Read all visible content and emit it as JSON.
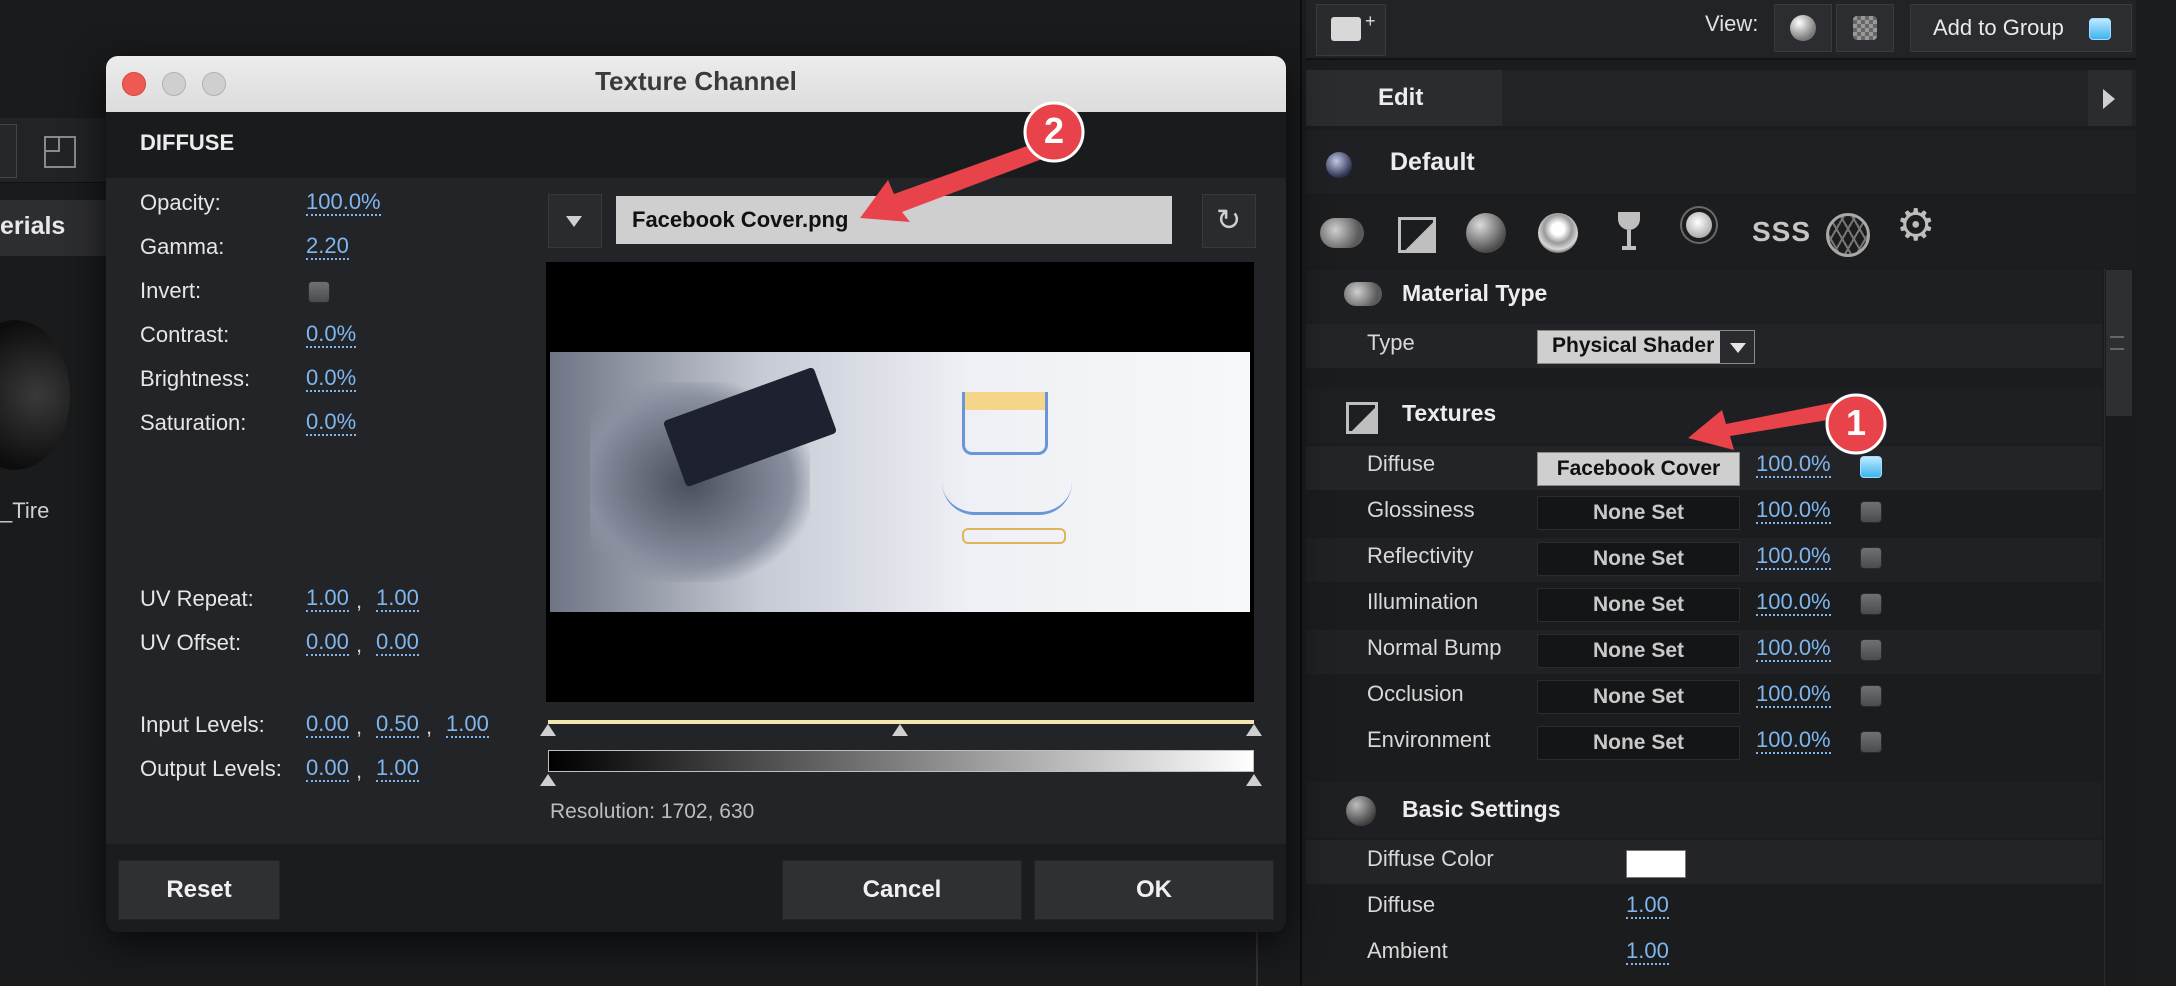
{
  "background": {
    "materials_tab_fragment": "erials",
    "tire_fragment": "_Tire"
  },
  "top_bar": {
    "view_label": "View:",
    "add_to_group_label": "Add to Group"
  },
  "right_panel": {
    "edit_tab": "Edit",
    "material_name": "Default",
    "toolbar_icons": [
      "material-icon",
      "image-icon",
      "sphere-icon",
      "metal-sphere-icon",
      "glass-icon",
      "light-bulb-icon",
      "sss-icon",
      "geodesic-icon",
      "gear-icon"
    ],
    "sss_text": "SSS",
    "material_type": {
      "heading": "Material Type",
      "type_label": "Type",
      "type_value": "Physical Shader"
    },
    "textures": {
      "heading": "Textures",
      "rows": [
        {
          "label": "Diffuse",
          "value": "Facebook Cover",
          "pct": "100.0%",
          "checked": true
        },
        {
          "label": "Glossiness",
          "value": "None Set",
          "pct": "100.0%",
          "checked": false
        },
        {
          "label": "Reflectivity",
          "value": "None Set",
          "pct": "100.0%",
          "checked": false
        },
        {
          "label": "Illumination",
          "value": "None Set",
          "pct": "100.0%",
          "checked": false
        },
        {
          "label": "Normal Bump",
          "value": "None Set",
          "pct": "100.0%",
          "checked": false
        },
        {
          "label": "Occlusion",
          "value": "None Set",
          "pct": "100.0%",
          "checked": false
        },
        {
          "label": "Environment",
          "value": "None Set",
          "pct": "100.0%",
          "checked": false
        }
      ]
    },
    "basic_settings": {
      "heading": "Basic Settings",
      "diffuse_color_label": "Diffuse Color",
      "diffuse_color": "#ffffff",
      "diffuse_label": "Diffuse",
      "diffuse_value": "1.00",
      "ambient_label": "Ambient",
      "ambient_value": "1.00"
    }
  },
  "dialog": {
    "title": "Texture Channel",
    "section": "DIFFUSE",
    "opacity_label": "Opacity:",
    "opacity": "100.0%",
    "gamma_label": "Gamma:",
    "gamma": "2.20",
    "invert_label": "Invert:",
    "contrast_label": "Contrast:",
    "contrast": "0.0%",
    "brightness_label": "Brightness:",
    "brightness": "0.0%",
    "saturation_label": "Saturation:",
    "saturation": "0.0%",
    "uv_repeat_label": "UV Repeat:",
    "uv_repeat": [
      "1.00",
      "1.00"
    ],
    "uv_offset_label": "UV Offset:",
    "uv_offset": [
      "0.00",
      "0.00"
    ],
    "input_levels_label": "Input Levels:",
    "input_levels": [
      "0.00",
      "0.50",
      "1.00"
    ],
    "output_levels_label": "Output Levels:",
    "output_levels": [
      "0.00",
      "1.00"
    ],
    "separator": ",",
    "filename": "Facebook Cover.png",
    "resolution": "Resolution: 1702, 630",
    "reset": "Reset",
    "cancel": "Cancel",
    "ok": "OK"
  },
  "annotations": [
    "1",
    "2"
  ],
  "accent_red": "#e8434a",
  "link_blue": "#7fb6ee"
}
